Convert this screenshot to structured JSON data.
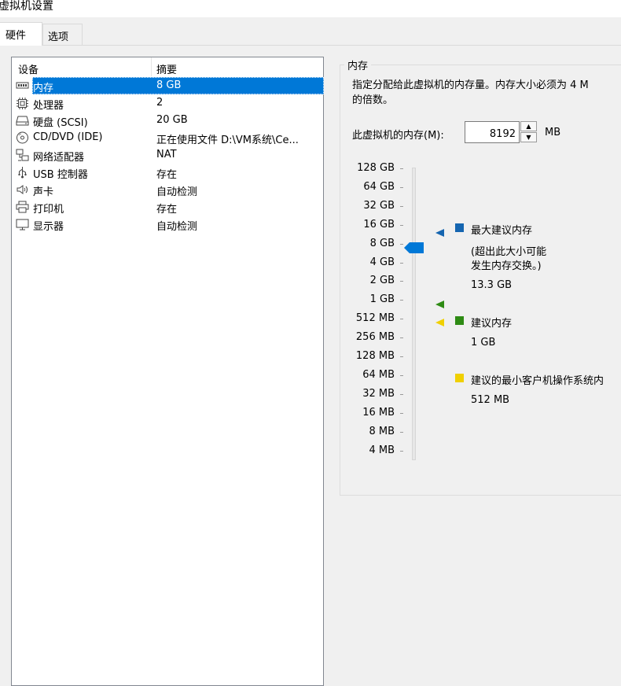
{
  "window": {
    "title": "虚拟机设置"
  },
  "tabs": [
    {
      "label": "硬件",
      "active": true
    },
    {
      "label": "选项",
      "active": false
    }
  ],
  "device_table": {
    "columns": [
      "设备",
      "摘要"
    ],
    "rows": [
      {
        "icon": "memory-icon",
        "name": "内存",
        "summary": "8 GB",
        "selected": true
      },
      {
        "icon": "processor-icon",
        "name": "处理器",
        "summary": "2"
      },
      {
        "icon": "hard-disk-icon",
        "name": "硬盘 (SCSI)",
        "summary": "20 GB"
      },
      {
        "icon": "cd-dvd-icon",
        "name": "CD/DVD (IDE)",
        "summary": "正在使用文件 D:\\VM系统\\Ce..."
      },
      {
        "icon": "network-adapter-icon",
        "name": "网络适配器",
        "summary": "NAT"
      },
      {
        "icon": "usb-icon",
        "name": "USB 控制器",
        "summary": "存在"
      },
      {
        "icon": "sound-card-icon",
        "name": "声卡",
        "summary": "自动检测"
      },
      {
        "icon": "printer-icon",
        "name": "打印机",
        "summary": "存在"
      },
      {
        "icon": "display-icon",
        "name": "显示器",
        "summary": "自动检测"
      }
    ]
  },
  "memory_panel": {
    "group_title": "内存",
    "description_line1": "指定分配给此虚拟机的内存量。内存大小必须为 4 M",
    "description_line2": "的倍数。",
    "field_label": "此虚拟机的内存(M):",
    "field_value": "8192",
    "unit": "MB",
    "scale_labels": [
      "128 GB",
      "64 GB",
      "32 GB",
      "16 GB",
      "8 GB",
      "4 GB",
      "2 GB",
      "1 GB",
      "512 MB",
      "256 MB",
      "128 MB",
      "64 MB",
      "32 MB",
      "16 MB",
      "8 MB",
      "4 MB"
    ],
    "current_value": "8 GB",
    "legend": {
      "max": {
        "title": "最大建议内存",
        "note_line1": "(超出此大小可能",
        "note_line2": "发生内存交换。)",
        "value": "13.3 GB",
        "color": "#1565b0"
      },
      "recommended": {
        "title": "建议内存",
        "value": "1 GB",
        "color": "#2e8b14"
      },
      "min_guest": {
        "title": "建议的最小客户机操作系统内",
        "value": "512 MB",
        "color": "#f0d000"
      }
    },
    "accent_color": "#0078d7"
  }
}
